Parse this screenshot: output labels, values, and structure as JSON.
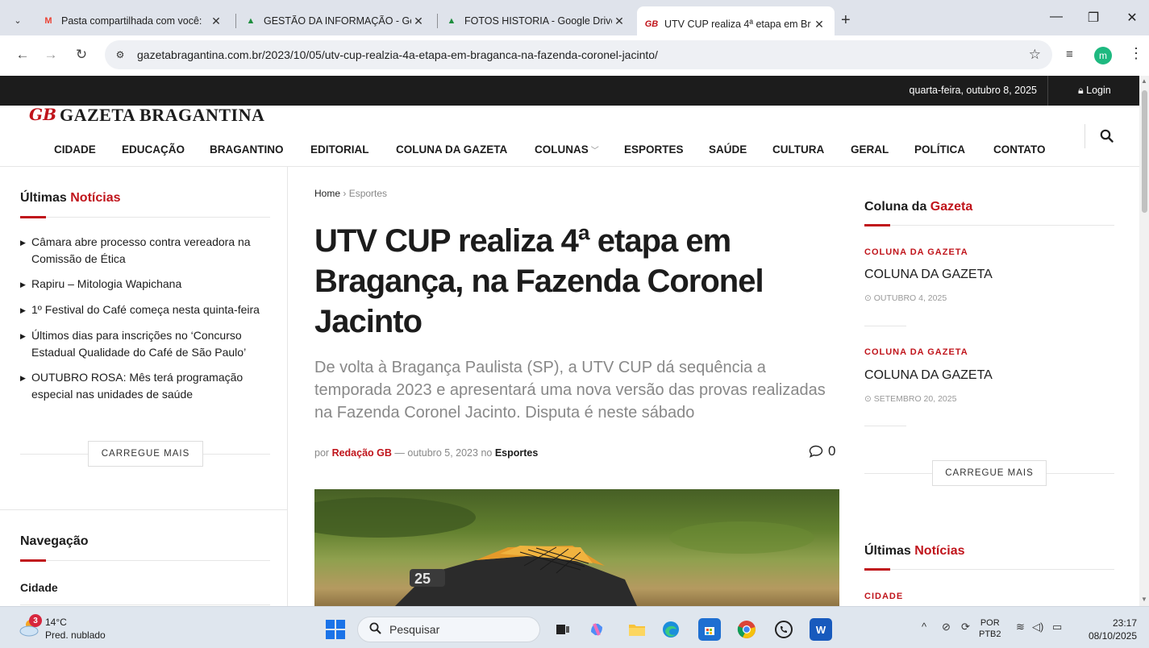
{
  "browser": {
    "tabs": [
      {
        "favicon": "M",
        "favicon_color": "#ea4335",
        "title": "Pasta compartilhada com você:"
      },
      {
        "favicon": "▲",
        "favicon_color": "#1e8e3e",
        "title": "GESTÃO DA INFORMAÇÃO - Go"
      },
      {
        "favicon": "▲",
        "favicon_color": "#1e8e3e",
        "title": "FOTOS HISTORIA - Google Drive"
      },
      {
        "favicon": "GB",
        "favicon_color": "#c0141b",
        "title": "UTV CUP realiza 4ª etapa em Br"
      }
    ],
    "url": "gazetabragantina.com.br/2023/10/05/utv-cup-realzia-4a-etapa-em-braganca-na-fazenda-coronel-jacinto/",
    "profile_initial": "m"
  },
  "site": {
    "date": "quarta-feira, outubro 8, 2025",
    "login": "Login",
    "logo_mark": "GB",
    "logo_name": "GAZETA BRAGANTINA",
    "nav": [
      "CIDADE",
      "EDUCAÇÃO",
      "BRAGANTINO",
      "EDITORIAL",
      "COLUNA DA GAZETA",
      "COLUNAS",
      "ESPORTES",
      "SAÚDE",
      "CULTURA",
      "GERAL",
      "POLÍTICA",
      "CONTATO"
    ],
    "accent_color": "#c0141b"
  },
  "left_sidebar": {
    "title_plain": "Últimas",
    "title_accent": "Notícias",
    "news": [
      "Câmara abre processo contra vereadora na Comissão de Ética",
      "Rapiru – Mitologia Wapichana",
      "1º Festival do Café começa nesta quinta-feira",
      "Últimos dias para inscrições no ‘Concurso Estadual Qualidade do Café de São Paulo’",
      "OUTUBRO ROSA: Mês terá programação especial nas unidades de saúde"
    ],
    "load_more": "CARREGUE MAIS",
    "nav_title": "Navegação",
    "nav_link": "Cidade"
  },
  "article": {
    "breadcrumb_home": "Home",
    "breadcrumb_sep": "›",
    "breadcrumb_section": "Esportes",
    "title": "UTV CUP realiza 4ª etapa em Bragança, na Fazenda Coronel Jacinto",
    "subtitle": "De volta à Bragança Paulista (SP), a UTV CUP dá sequência a temporada 2023 e apresentará uma nova versão das provas realizadas na Fazenda Coronel Jacinto. Disputa é neste sábado",
    "meta_by": "por",
    "author": "Redação GB",
    "meta_dash": "—",
    "date": "outubro 5, 2023",
    "meta_in": "no",
    "category": "Esportes",
    "comments": "0",
    "image_number": "25"
  },
  "right_sidebar": {
    "title_plain": "Coluna da",
    "title_accent": "Gazeta",
    "posts": [
      {
        "category": "COLUNA DA GAZETA",
        "title": "COLUNA DA GAZETA",
        "date": "OUTUBRO 4, 2025"
      },
      {
        "category": "COLUNA DA GAZETA",
        "title": "COLUNA DA GAZETA",
        "date": "SETEMBRO 20, 2025"
      }
    ],
    "load_more": "CARREGUE MAIS",
    "latest_plain": "Últimas",
    "latest_accent": "Notícias",
    "latest_category": "CIDADE"
  },
  "taskbar": {
    "weather_badge": "3",
    "temperature": "14°C",
    "weather": "Pred. nublado",
    "search_placeholder": "Pesquisar",
    "lang_top": "POR",
    "lang_bottom": "PTB2",
    "time": "23:17",
    "date": "08/10/2025"
  }
}
